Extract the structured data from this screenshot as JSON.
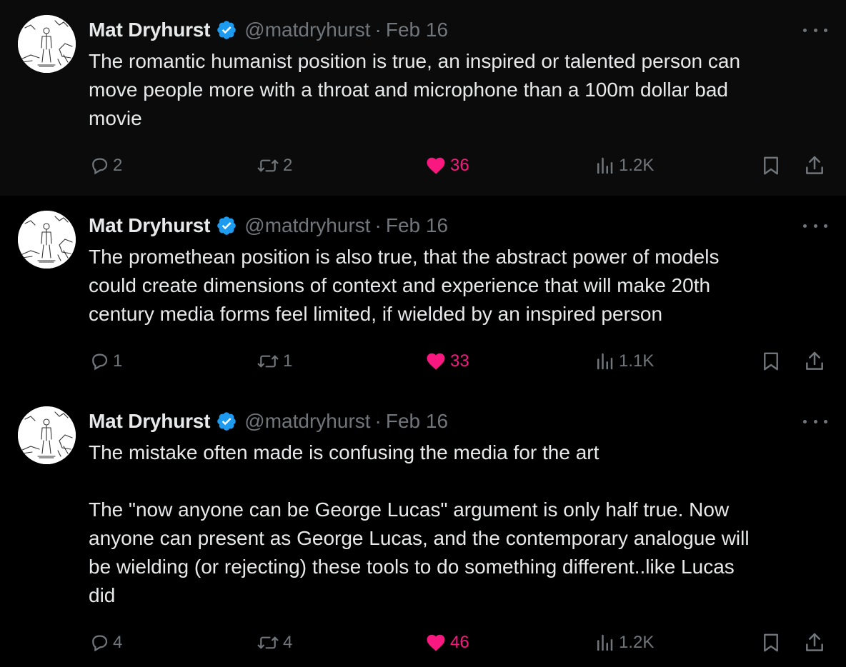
{
  "colors": {
    "background": "#000000",
    "first_tweet_background": "#0b0b0b",
    "text": "#e7e9ea",
    "muted": "#71767b",
    "like": "#f91880",
    "verified": "#1d9bf0",
    "thread_line": "#333639"
  },
  "tweets": [
    {
      "author": "Mat Dryhurst",
      "handle": "@matdryhurst",
      "separator": "·",
      "date": "Feb 16",
      "text": "The romantic humanist position is true, an inspired or talented person can\nmove people more with a throat and microphone than a 100m dollar bad\nmovie",
      "replies": "2",
      "retweets": "2",
      "likes": "36",
      "views": "1.2K",
      "liked": true
    },
    {
      "author": "Mat Dryhurst",
      "handle": "@matdryhurst",
      "separator": "·",
      "date": "Feb 16",
      "text": "The promethean position is also true, that the abstract power of models\ncould create dimensions of context and experience that will make 20th\ncentury media forms feel limited, if wielded by an inspired person",
      "replies": "1",
      "retweets": "1",
      "likes": "33",
      "views": "1.1K",
      "liked": true
    },
    {
      "author": "Mat Dryhurst",
      "handle": "@matdryhurst",
      "separator": "·",
      "date": "Feb 16",
      "text": "The mistake often made is confusing the media for the art\n\nThe \"now anyone can be George Lucas\" argument is only half true. Now\nanyone can present as George Lucas, and the contemporary analogue will\nbe wielding (or rejecting) these tools to do something different..like Lucas\ndid",
      "replies": "4",
      "retweets": "4",
      "likes": "46",
      "views": "1.2K",
      "liked": true
    }
  ],
  "icons": {
    "reply": "reply-icon",
    "retweet": "retweet-icon",
    "like": "heart-icon",
    "views": "views-icon",
    "bookmark": "bookmark-icon",
    "share": "share-icon",
    "more": "more-options-icon",
    "verified": "verified-badge-icon"
  }
}
